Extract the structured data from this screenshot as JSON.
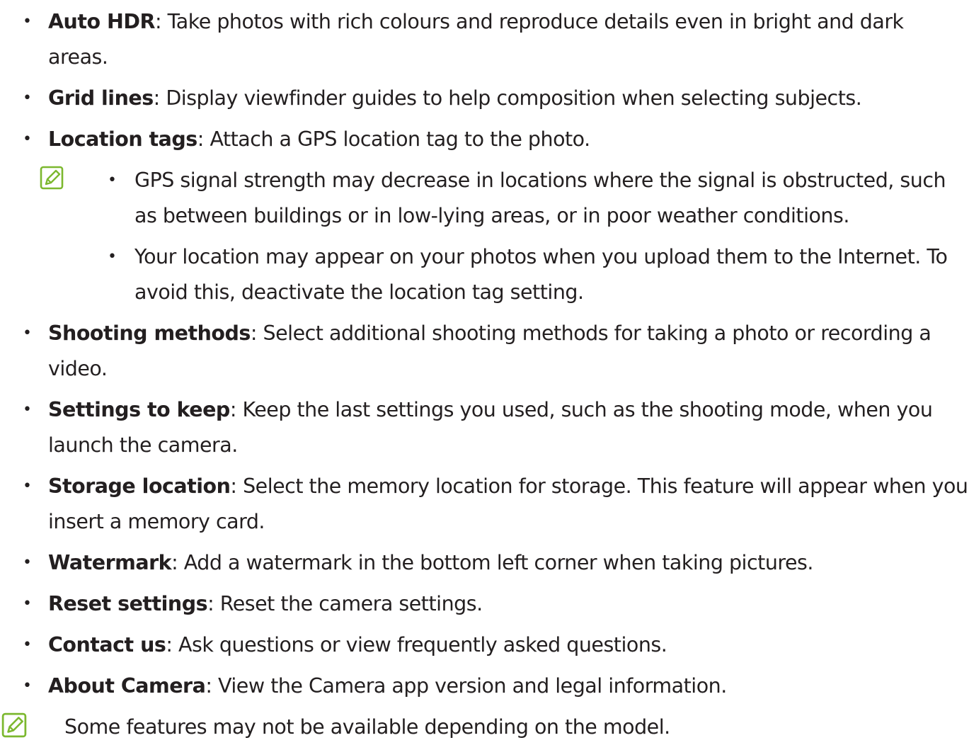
{
  "items_top": [
    {
      "term": "Auto HDR",
      "text": ": Take photos with rich colours and reproduce details even in bright and dark areas."
    },
    {
      "term": "Grid lines",
      "text": ": Display viewfinder guides to help composition when selecting subjects."
    },
    {
      "term": "Location tags",
      "text": ": Attach a GPS location tag to the photo."
    }
  ],
  "location_note": {
    "icon": "note-icon",
    "points": [
      "GPS signal strength may decrease in locations where the signal is obstructed, such as between buildings or in low-lying areas, or in poor weather conditions.",
      "Your location may appear on your photos when you upload them to the Internet. To avoid this, deactivate the location tag setting."
    ]
  },
  "items_bottom": [
    {
      "term": "Shooting methods",
      "text": ": Select additional shooting methods for taking a photo or recording a video."
    },
    {
      "term": "Settings to keep",
      "text": ": Keep the last settings you used, such as the shooting mode, when you launch the camera."
    },
    {
      "term": "Storage location",
      "text": ": Select the memory location for storage. This feature will appear when you insert a memory card."
    },
    {
      "term": "Watermark",
      "text": ": Add a watermark in the bottom left corner when taking pictures."
    },
    {
      "term": "Reset settings",
      "text": ": Reset the camera settings."
    },
    {
      "term": "Contact us",
      "text": ": Ask questions or view frequently asked questions."
    },
    {
      "term": "About Camera",
      "text": ": View the Camera app version and legal information."
    }
  ],
  "footer_note": {
    "icon": "note-icon",
    "text": "Some features may not be available depending on the model."
  },
  "bullet_glyph": "•",
  "colors": {
    "text": "#231f20",
    "note_icon": "#7cb82f"
  }
}
